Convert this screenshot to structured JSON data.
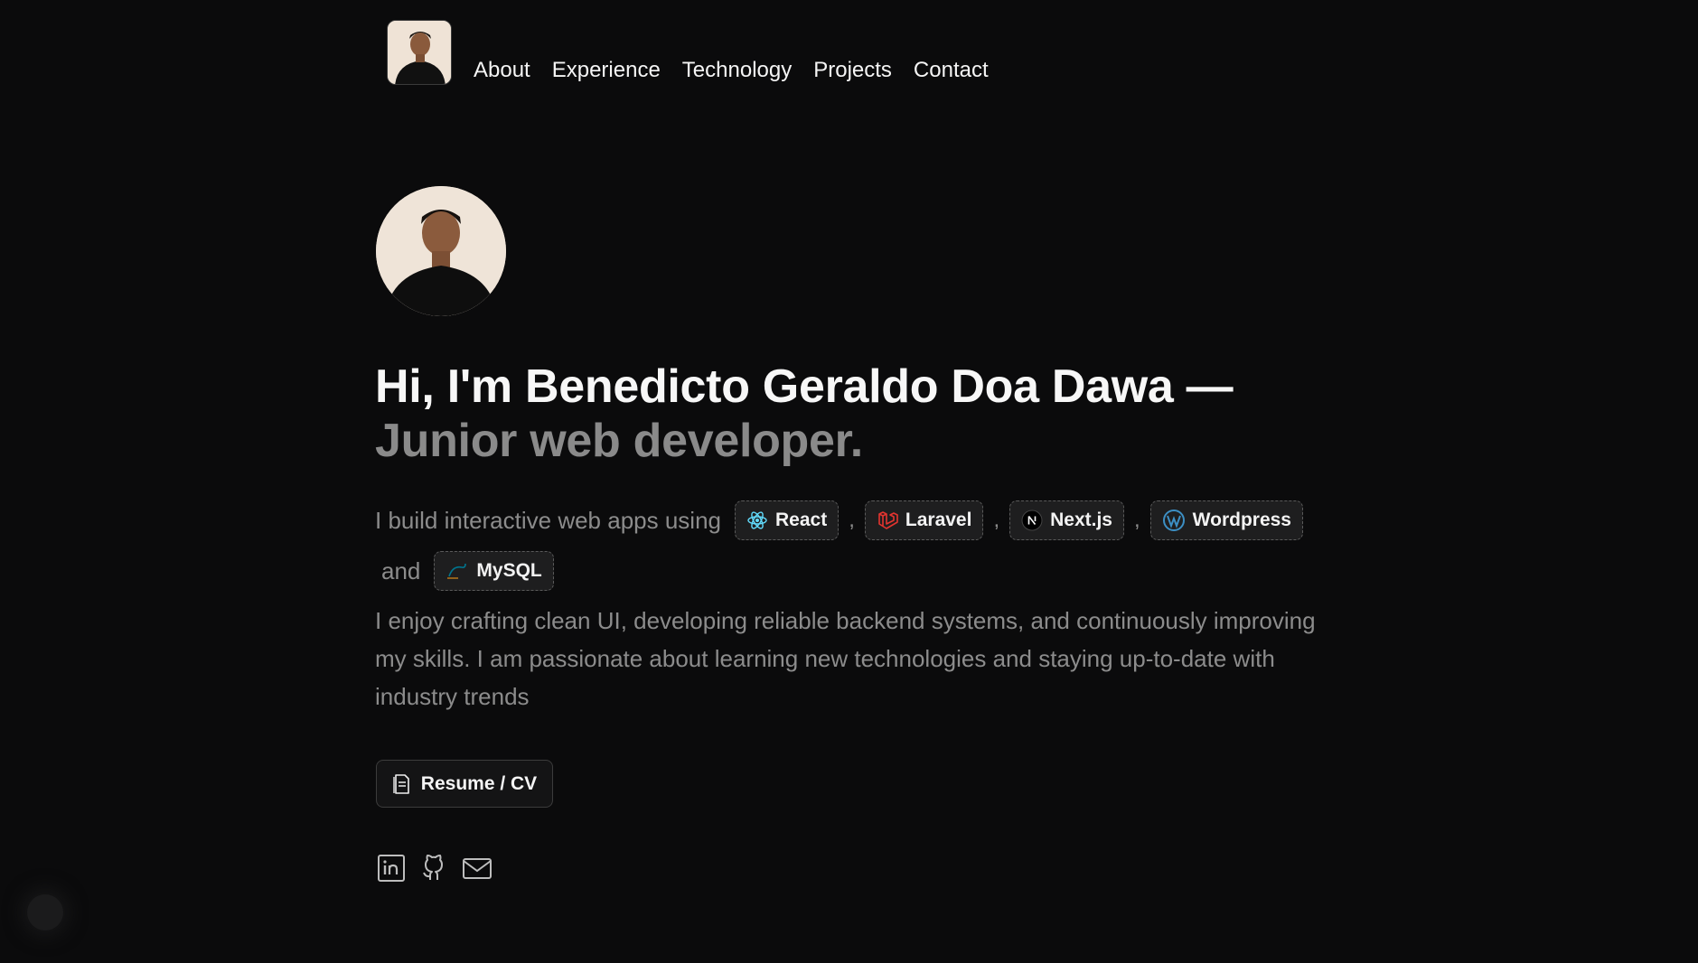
{
  "nav": {
    "links": [
      "About",
      "Experience",
      "Technology",
      "Projects",
      "Contact"
    ]
  },
  "hero": {
    "headline_line1": "Hi, I'm Benedicto Geraldo Doa Dawa —",
    "headline_line2": "Junior web developer.",
    "intro_prefix": "I build interactive web apps using",
    "chips": [
      {
        "label": "React",
        "icon": "react-icon",
        "color": "#61dafb"
      },
      {
        "label": "Laravel",
        "icon": "laravel-icon",
        "color": "#e3342f"
      },
      {
        "label": "Next.js",
        "icon": "nextjs-icon",
        "color": "#000000"
      },
      {
        "label": "Wordpress",
        "icon": "wordpress-icon",
        "color": "#3c8fc4"
      },
      {
        "label": "MySQL",
        "icon": "mysql-icon",
        "color": "#00758f"
      }
    ],
    "separator": ",",
    "and_word": "and",
    "paragraph": " I enjoy crafting clean UI, developing reliable backend systems, and continuously improving my skills. I am passionate about learning new technologies and staying up-to-date with industry trends",
    "resume_label": "Resume / CV"
  },
  "socials": [
    {
      "icon": "linkedin-icon"
    },
    {
      "icon": "github-icon"
    },
    {
      "icon": "mail-icon"
    }
  ],
  "colors": {
    "background": "#0b0b0c",
    "text_primary": "#f5f5f5",
    "text_muted": "#8c8c8c",
    "chip_bg": "#1e1e1f"
  }
}
